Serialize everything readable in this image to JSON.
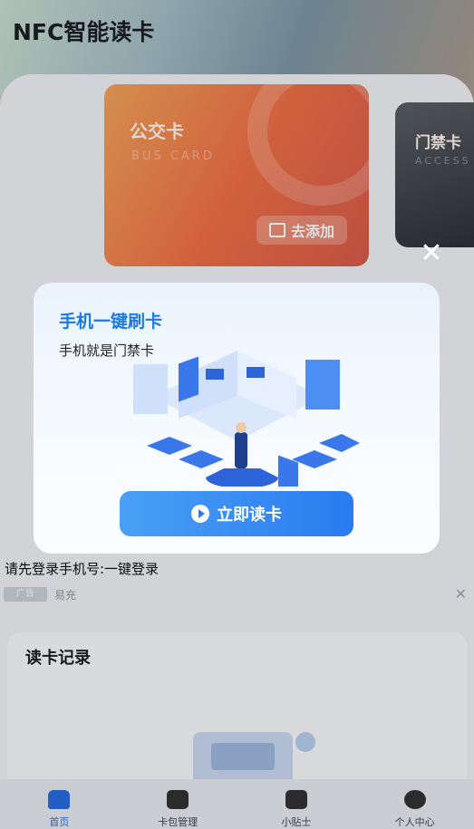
{
  "header": {
    "title": "NFC智能读卡"
  },
  "cards": [
    {
      "title": "公交卡",
      "subtitle": "BUS CARD",
      "action": "去添加"
    },
    {
      "title": "门禁卡",
      "subtitle": "ACCESS"
    }
  ],
  "popup": {
    "title": "手机一键刷卡",
    "subtitle": "手机就是门禁卡",
    "button": "立即读卡",
    "close": "✕"
  },
  "login_tip": "请先登录手机号:一键登录",
  "ad": {
    "tag": "广告",
    "name": "易充",
    "close": "✕"
  },
  "records": {
    "title": "读卡记录"
  },
  "nav": [
    {
      "label": "首页",
      "icon": "home-icon",
      "active": true
    },
    {
      "label": "卡包管理",
      "icon": "wallet-icon",
      "active": false
    },
    {
      "label": "小贴士",
      "icon": "megaphone-icon",
      "active": false
    },
    {
      "label": "个人中心",
      "icon": "user-icon",
      "active": false
    }
  ],
  "colors": {
    "accent": "#2a6be0",
    "popup_title": "#1a7ae8",
    "bus_card": "#ee7046"
  }
}
